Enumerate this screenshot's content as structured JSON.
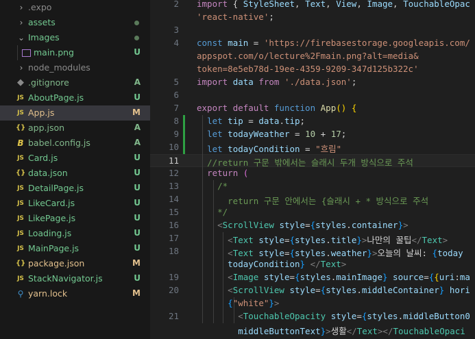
{
  "explorer": {
    "items": [
      {
        "label": ".expo",
        "type": "folder",
        "status": "",
        "dot": false
      },
      {
        "label": "assets",
        "type": "folder",
        "status": "",
        "dot": true
      },
      {
        "label": "Images",
        "type": "folder-open",
        "status": "",
        "dot": true
      },
      {
        "label": "main.png",
        "type": "image",
        "status": "U",
        "dot": false
      },
      {
        "label": "node_modules",
        "type": "folder",
        "status": "",
        "dot": false
      },
      {
        "label": ".gitignore",
        "type": "git",
        "status": "A",
        "dot": false
      },
      {
        "label": "AboutPage.js",
        "type": "js",
        "status": "U",
        "dot": false
      },
      {
        "label": "App.js",
        "type": "js",
        "status": "M",
        "dot": false,
        "selected": true
      },
      {
        "label": "app.json",
        "type": "json",
        "status": "A",
        "dot": false
      },
      {
        "label": "babel.config.js",
        "type": "babel",
        "status": "A",
        "dot": false
      },
      {
        "label": "Card.js",
        "type": "js",
        "status": "U",
        "dot": false
      },
      {
        "label": "data.json",
        "type": "json",
        "status": "U",
        "dot": false
      },
      {
        "label": "DetailPage.js",
        "type": "js",
        "status": "U",
        "dot": false
      },
      {
        "label": "LikeCard.js",
        "type": "js",
        "status": "U",
        "dot": false
      },
      {
        "label": "LikePage.js",
        "type": "js",
        "status": "U",
        "dot": false
      },
      {
        "label": "Loading.js",
        "type": "js",
        "status": "U",
        "dot": false
      },
      {
        "label": "MainPage.js",
        "type": "js",
        "status": "U",
        "dot": false
      },
      {
        "label": "package.json",
        "type": "json",
        "status": "M",
        "dot": false
      },
      {
        "label": "StackNavigator.js",
        "type": "js",
        "status": "U",
        "dot": false
      },
      {
        "label": "yarn.lock",
        "type": "yarn",
        "status": "M",
        "dot": false
      }
    ]
  },
  "editor": {
    "lines": [
      {
        "n": "2",
        "tokens": [
          [
            "kw2",
            "import"
          ],
          [
            "txt",
            " { "
          ],
          [
            "var",
            "StyleSheet"
          ],
          [
            "txt",
            ", "
          ],
          [
            "var",
            "Text"
          ],
          [
            "txt",
            ", "
          ],
          [
            "var",
            "View"
          ],
          [
            "txt",
            ", "
          ],
          [
            "var",
            "Image"
          ],
          [
            "txt",
            ", "
          ],
          [
            "var",
            "TouchableOpac"
          ]
        ]
      },
      {
        "n": "",
        "tokens": [
          [
            "str",
            "'react-native'"
          ],
          [
            "txt",
            ";"
          ]
        ]
      },
      {
        "n": "3",
        "tokens": []
      },
      {
        "n": "4",
        "tokens": [
          [
            "kw",
            "const"
          ],
          [
            "txt",
            " "
          ],
          [
            "var",
            "main"
          ],
          [
            "txt",
            " = "
          ],
          [
            "str",
            "'https://firebasestorage.googleapis.com/"
          ]
        ]
      },
      {
        "n": "",
        "tokens": [
          [
            "str",
            "appspot.com/o/lecture%2Fmain.png?alt=media&"
          ]
        ]
      },
      {
        "n": "",
        "tokens": [
          [
            "str",
            "token=8e5eb78d-19ee-4359-9209-347d125b322c'"
          ]
        ]
      },
      {
        "n": "5",
        "tokens": [
          [
            "kw2",
            "import"
          ],
          [
            "txt",
            " "
          ],
          [
            "var",
            "data"
          ],
          [
            "txt",
            " "
          ],
          [
            "kw2",
            "from"
          ],
          [
            "txt",
            " "
          ],
          [
            "str",
            "'./data.json'"
          ],
          [
            "txt",
            ";"
          ]
        ]
      },
      {
        "n": "6",
        "tokens": []
      },
      {
        "n": "7",
        "tokens": [
          [
            "kw2",
            "export"
          ],
          [
            "txt",
            " "
          ],
          [
            "kw2",
            "default"
          ],
          [
            "txt",
            " "
          ],
          [
            "kw",
            "function"
          ],
          [
            "txt",
            " "
          ],
          [
            "fn",
            "App"
          ],
          [
            "br",
            "()"
          ],
          [
            "txt",
            " "
          ],
          [
            "br",
            "{"
          ]
        ]
      },
      {
        "n": "8",
        "tokens": [
          [
            "txt",
            "  "
          ],
          [
            "kw",
            "let"
          ],
          [
            "txt",
            " "
          ],
          [
            "var",
            "tip"
          ],
          [
            "txt",
            " = "
          ],
          [
            "var",
            "data"
          ],
          [
            "txt",
            "."
          ],
          [
            "var",
            "tip"
          ],
          [
            "txt",
            ";"
          ]
        ]
      },
      {
        "n": "9",
        "tokens": [
          [
            "txt",
            "  "
          ],
          [
            "kw",
            "let"
          ],
          [
            "txt",
            " "
          ],
          [
            "var",
            "todayWeather"
          ],
          [
            "txt",
            " = "
          ],
          [
            "num",
            "10"
          ],
          [
            "txt",
            " + "
          ],
          [
            "num",
            "17"
          ],
          [
            "txt",
            ";"
          ]
        ]
      },
      {
        "n": "10",
        "tokens": [
          [
            "txt",
            "  "
          ],
          [
            "kw",
            "let"
          ],
          [
            "txt",
            " "
          ],
          [
            "var",
            "todayCondition"
          ],
          [
            "txt",
            " = "
          ],
          [
            "str",
            "\"흐림\""
          ]
        ]
      },
      {
        "n": "11",
        "tokens": [
          [
            "txt",
            "  "
          ],
          [
            "cmt",
            "//return 구문 밖에서는 슬래시 두개 방식으로 주석"
          ]
        ]
      },
      {
        "n": "12",
        "tokens": [
          [
            "txt",
            "  "
          ],
          [
            "kw2",
            "return"
          ],
          [
            "txt",
            " "
          ],
          [
            "br2",
            "("
          ]
        ]
      },
      {
        "n": "13",
        "tokens": [
          [
            "txt",
            "    "
          ],
          [
            "cmt",
            "/*"
          ]
        ]
      },
      {
        "n": "14",
        "tokens": [
          [
            "txt",
            "      "
          ],
          [
            "cmt",
            "return 구문 안에서는 {슬래시 + * 방식으로 주석"
          ]
        ]
      },
      {
        "n": "15",
        "tokens": [
          [
            "txt",
            "    "
          ],
          [
            "cmt",
            "*/"
          ]
        ]
      },
      {
        "n": "16",
        "tokens": [
          [
            "txt",
            "    "
          ],
          [
            "tagb",
            "<"
          ],
          [
            "tag",
            "ScrollView"
          ],
          [
            "txt",
            " "
          ],
          [
            "prop",
            "style"
          ],
          [
            "txt",
            "="
          ],
          [
            "br3",
            "{"
          ],
          [
            "var",
            "styles"
          ],
          [
            "txt",
            "."
          ],
          [
            "var",
            "container"
          ],
          [
            "br3",
            "}"
          ],
          [
            "tagb",
            ">"
          ]
        ]
      },
      {
        "n": "17",
        "tokens": [
          [
            "txt",
            "      "
          ],
          [
            "tagb",
            "<"
          ],
          [
            "tag",
            "Text"
          ],
          [
            "txt",
            " "
          ],
          [
            "prop",
            "style"
          ],
          [
            "txt",
            "="
          ],
          [
            "br3",
            "{"
          ],
          [
            "var",
            "styles"
          ],
          [
            "txt",
            "."
          ],
          [
            "var",
            "title"
          ],
          [
            "br3",
            "}"
          ],
          [
            "tagb",
            ">"
          ],
          [
            "txt",
            "나만의 꿀팁"
          ],
          [
            "tagb",
            "</"
          ],
          [
            "tag",
            "Text"
          ],
          [
            "tagb",
            ">"
          ]
        ]
      },
      {
        "n": "18",
        "tokens": [
          [
            "txt",
            "      "
          ],
          [
            "tagb",
            "<"
          ],
          [
            "tag",
            "Text"
          ],
          [
            "txt",
            " "
          ],
          [
            "prop",
            "style"
          ],
          [
            "txt",
            "="
          ],
          [
            "br3",
            "{"
          ],
          [
            "var",
            "styles"
          ],
          [
            "txt",
            "."
          ],
          [
            "var",
            "weather"
          ],
          [
            "br3",
            "}"
          ],
          [
            "tagb",
            ">"
          ],
          [
            "txt",
            "오늘의 날씨: "
          ],
          [
            "br3",
            "{"
          ],
          [
            "var",
            "today"
          ]
        ]
      },
      {
        "n": "",
        "tokens": [
          [
            "txt",
            "      "
          ],
          [
            "var",
            "todayCondition"
          ],
          [
            "br3",
            "}"
          ],
          [
            "txt",
            " "
          ],
          [
            "tagb",
            "</"
          ],
          [
            "tag",
            "Text"
          ],
          [
            "tagb",
            ">"
          ]
        ]
      },
      {
        "n": "19",
        "tokens": [
          [
            "txt",
            "      "
          ],
          [
            "tagb",
            "<"
          ],
          [
            "tag",
            "Image"
          ],
          [
            "txt",
            " "
          ],
          [
            "prop",
            "style"
          ],
          [
            "txt",
            "="
          ],
          [
            "br3",
            "{"
          ],
          [
            "var",
            "styles"
          ],
          [
            "txt",
            "."
          ],
          [
            "var",
            "mainImage"
          ],
          [
            "br3",
            "}"
          ],
          [
            "txt",
            " "
          ],
          [
            "prop",
            "source"
          ],
          [
            "txt",
            "="
          ],
          [
            "br3",
            "{"
          ],
          [
            "br",
            "{"
          ],
          [
            "var",
            "uri"
          ],
          [
            "txt",
            ":"
          ],
          [
            "var",
            "ma"
          ]
        ]
      },
      {
        "n": "20",
        "tokens": [
          [
            "txt",
            "      "
          ],
          [
            "tagb",
            "<"
          ],
          [
            "tag",
            "ScrollView"
          ],
          [
            "txt",
            " "
          ],
          [
            "prop",
            "style"
          ],
          [
            "txt",
            "="
          ],
          [
            "br3",
            "{"
          ],
          [
            "var",
            "styles"
          ],
          [
            "txt",
            "."
          ],
          [
            "var",
            "middleContainer"
          ],
          [
            "br3",
            "}"
          ],
          [
            "txt",
            " "
          ],
          [
            "prop",
            "hori"
          ]
        ]
      },
      {
        "n": "",
        "tokens": [
          [
            "txt",
            "      "
          ],
          [
            "br3",
            "{"
          ],
          [
            "str",
            "\"white\""
          ],
          [
            "br3",
            "}"
          ],
          [
            "tagb",
            ">"
          ]
        ]
      },
      {
        "n": "21",
        "tokens": [
          [
            "txt",
            "        "
          ],
          [
            "tagb",
            "<"
          ],
          [
            "tag",
            "TouchableOpacity"
          ],
          [
            "txt",
            " "
          ],
          [
            "prop",
            "style"
          ],
          [
            "txt",
            "="
          ],
          [
            "br3",
            "{"
          ],
          [
            "var",
            "styles"
          ],
          [
            "txt",
            "."
          ],
          [
            "var",
            "middleButton0"
          ]
        ]
      },
      {
        "n": "",
        "tokens": [
          [
            "txt",
            "        "
          ],
          [
            "var",
            "middleButtonText"
          ],
          [
            "br3",
            "}"
          ],
          [
            "tagb",
            ">"
          ],
          [
            "txt",
            "생활"
          ],
          [
            "tagb",
            "</"
          ],
          [
            "tag",
            "Text"
          ],
          [
            "tagb",
            "></"
          ],
          [
            "tag",
            "TouchableOpaci"
          ]
        ]
      }
    ]
  }
}
